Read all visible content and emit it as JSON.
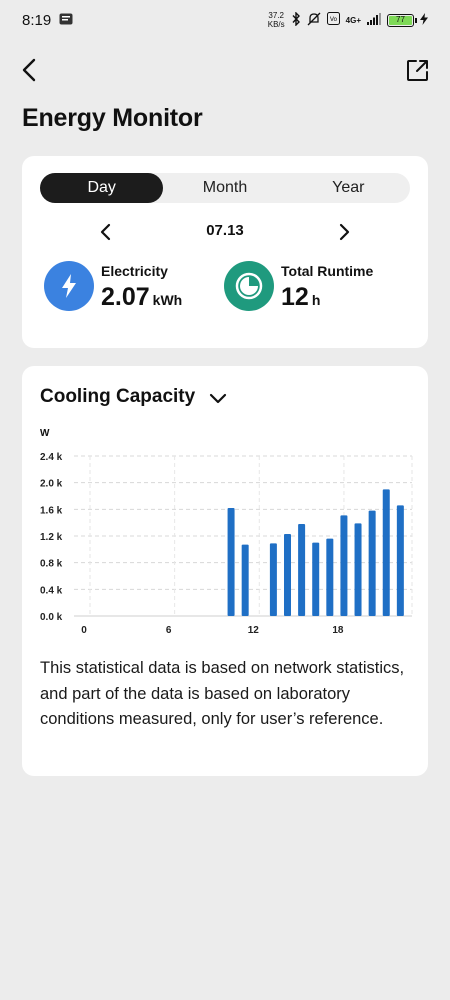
{
  "status_bar": {
    "time": "8:19",
    "net_speed_value": "37.2",
    "net_speed_unit": "KB/s",
    "network": "4G+",
    "battery": "77"
  },
  "header": {
    "title": "Energy Monitor"
  },
  "summary": {
    "tabs": [
      {
        "label": "Day",
        "active": true
      },
      {
        "label": "Month",
        "active": false
      },
      {
        "label": "Year",
        "active": false
      }
    ],
    "date": "07.13",
    "electricity": {
      "label": "Electricity",
      "value": "2.07",
      "unit": "kWh",
      "color": "#3b82e0"
    },
    "runtime": {
      "label": "Total Runtime",
      "value": "12",
      "unit": "h",
      "color": "#1f9a7e"
    }
  },
  "chart_section": {
    "title": "Cooling Capacity",
    "note": "This statistical data is based on network statistics, and part of the data is based on laboratory conditions measured, only for user’s reference."
  },
  "chart_data": {
    "type": "bar",
    "ylabel": "W",
    "ylim": [
      0,
      2.4
    ],
    "y_ticks": [
      "0.0 k",
      "0.4 k",
      "0.8 k",
      "1.2 k",
      "1.6 k",
      "2.0 k",
      "2.4 k"
    ],
    "x_ticks": [
      "0",
      "6",
      "12",
      "18"
    ],
    "x": [
      0,
      1,
      2,
      3,
      4,
      5,
      6,
      7,
      8,
      9,
      10,
      11,
      12,
      13,
      14,
      15,
      16,
      17,
      18,
      19,
      20,
      21,
      22,
      23
    ],
    "values": [
      0,
      0,
      0,
      0,
      0,
      0,
      0,
      0,
      0,
      0,
      1.62,
      1.07,
      0,
      1.09,
      1.23,
      1.38,
      1.1,
      1.16,
      1.51,
      1.39,
      1.58,
      1.9,
      1.66,
      0
    ],
    "bar_color": "#1f6fc5",
    "grid": true
  }
}
